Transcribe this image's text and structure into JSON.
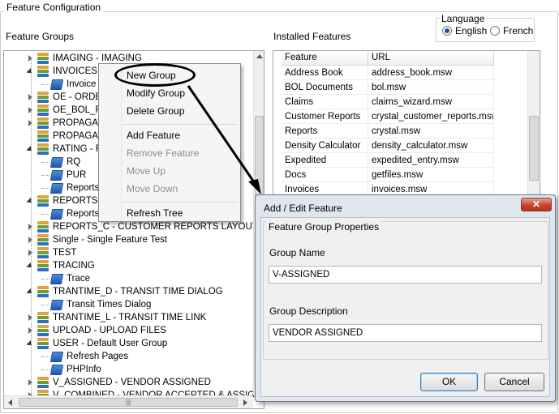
{
  "window": {
    "title": "Feature Configuration"
  },
  "labels": {
    "feature_groups": "Feature Groups",
    "installed_features": "Installed Features"
  },
  "language": {
    "title": "Language",
    "options": [
      {
        "label": "English",
        "selected": true
      },
      {
        "label": "French",
        "selected": false
      }
    ]
  },
  "tree": {
    "items": [
      {
        "label": "IMAGING - IMAGING",
        "level": 0,
        "expander": "closed",
        "icon": "feature-group-icon"
      },
      {
        "label": "INVOICES -",
        "level": 0,
        "expander": "open",
        "icon": "feature-group-icon"
      },
      {
        "label": "Invoice",
        "level": 1,
        "expander": "none",
        "icon": "feature-book-icon"
      },
      {
        "label": "OE - ORDE",
        "level": 0,
        "expander": "closed",
        "icon": "feature-group-icon"
      },
      {
        "label": "OE_BOL_R",
        "level": 0,
        "expander": "closed",
        "icon": "feature-group-icon"
      },
      {
        "label": "PROPAGAT",
        "level": 0,
        "expander": "closed",
        "icon": "feature-group-icon"
      },
      {
        "label": "PROPAGAT",
        "level": 0,
        "expander": "none",
        "icon": "feature-group-icon"
      },
      {
        "label": "RATING - R",
        "level": 0,
        "expander": "open",
        "icon": "feature-group-icon"
      },
      {
        "label": "RQ",
        "level": 1,
        "expander": "none",
        "icon": "feature-book-icon"
      },
      {
        "label": "PUR",
        "level": 1,
        "expander": "none",
        "icon": "feature-book-icon"
      },
      {
        "label": "Reports",
        "level": 1,
        "expander": "none",
        "icon": "feature-book-icon"
      },
      {
        "label": "REPORTS -",
        "level": 0,
        "expander": "open",
        "icon": "feature-group-icon"
      },
      {
        "label": "Reports",
        "level": 1,
        "expander": "none",
        "icon": "feature-book-icon"
      },
      {
        "label": "REPORTS_C - CUSTOMER REPORTS LAYOUT",
        "level": 0,
        "expander": "closed",
        "icon": "feature-group-icon"
      },
      {
        "label": "Single - Single Feature Test",
        "level": 0,
        "expander": "closed",
        "icon": "feature-group-icon"
      },
      {
        "label": "TEST",
        "level": 0,
        "expander": "closed",
        "icon": "feature-group-icon"
      },
      {
        "label": "TRACING",
        "level": 0,
        "expander": "open",
        "icon": "feature-group-icon"
      },
      {
        "label": "Trace",
        "level": 1,
        "expander": "none",
        "icon": "feature-book-icon"
      },
      {
        "label": "TRANTIME_D - TRANSIT TIME DIALOG",
        "level": 0,
        "expander": "open",
        "icon": "feature-group-icon"
      },
      {
        "label": "Transit Times Dialog",
        "level": 1,
        "expander": "none",
        "icon": "feature-book-icon"
      },
      {
        "label": "TRANTIME_L - TRANSIT TIME LINK",
        "level": 0,
        "expander": "closed",
        "icon": "feature-group-icon"
      },
      {
        "label": "UPLOAD - UPLOAD FILES",
        "level": 0,
        "expander": "closed",
        "icon": "feature-group-icon"
      },
      {
        "label": "USER - Default User Group",
        "level": 0,
        "expander": "open",
        "icon": "feature-group-icon"
      },
      {
        "label": "Refresh Pages",
        "level": 1,
        "expander": "none",
        "icon": "feature-book-icon"
      },
      {
        "label": "PHPInfo",
        "level": 1,
        "expander": "none",
        "icon": "feature-book-icon"
      },
      {
        "label": "V_ASSIGNED - VENDOR ASSIGNED",
        "level": 0,
        "expander": "closed",
        "icon": "feature-group-icon"
      },
      {
        "label": "V_COMBINED - VENDOR ACCEPTED & ASSIGNED",
        "level": 0,
        "expander": "closed",
        "icon": "feature-group-icon"
      }
    ]
  },
  "features_table": {
    "columns": [
      "Feature",
      "URL"
    ],
    "rows": [
      [
        "Address Book",
        "address_book.msw"
      ],
      [
        "BOL Documents",
        "bol.msw"
      ],
      [
        "Claims",
        "claims_wizard.msw"
      ],
      [
        "Customer Reports",
        "crystal_customer_reports.msw"
      ],
      [
        "Reports",
        "crystal.msw"
      ],
      [
        "Density Calculator",
        "density_calculator.msw"
      ],
      [
        "Expedited",
        "expedited_entry.msw"
      ],
      [
        "Docs",
        "getfiles.msw"
      ],
      [
        "Invoices",
        "invoices.msw"
      ]
    ]
  },
  "context_menu": {
    "items": [
      {
        "label": "New Group",
        "enabled": true
      },
      {
        "label": "Modify Group",
        "enabled": true
      },
      {
        "label": "Delete Group",
        "enabled": true
      },
      {
        "label": "Add Feature",
        "enabled": true
      },
      {
        "label": "Remove Feature",
        "enabled": false
      },
      {
        "label": "Move Up",
        "enabled": false
      },
      {
        "label": "Move Down",
        "enabled": false
      },
      {
        "label": "Refresh Tree",
        "enabled": true
      }
    ]
  },
  "dialog": {
    "title": "Add / Edit Feature",
    "close": "✕",
    "group_title": "Feature Group Properties",
    "group_name_label": "Group Name",
    "group_name_value": "V-ASSIGNED",
    "group_description_label": "Group Description",
    "group_description_value": "VENDOR ASSIGNED",
    "ok_label": "OK",
    "cancel_label": "Cancel"
  },
  "scrollbar_glyphs": {
    "up": "▲",
    "down": "▼",
    "left": "◄",
    "right": "►",
    "grip": "|||"
  }
}
